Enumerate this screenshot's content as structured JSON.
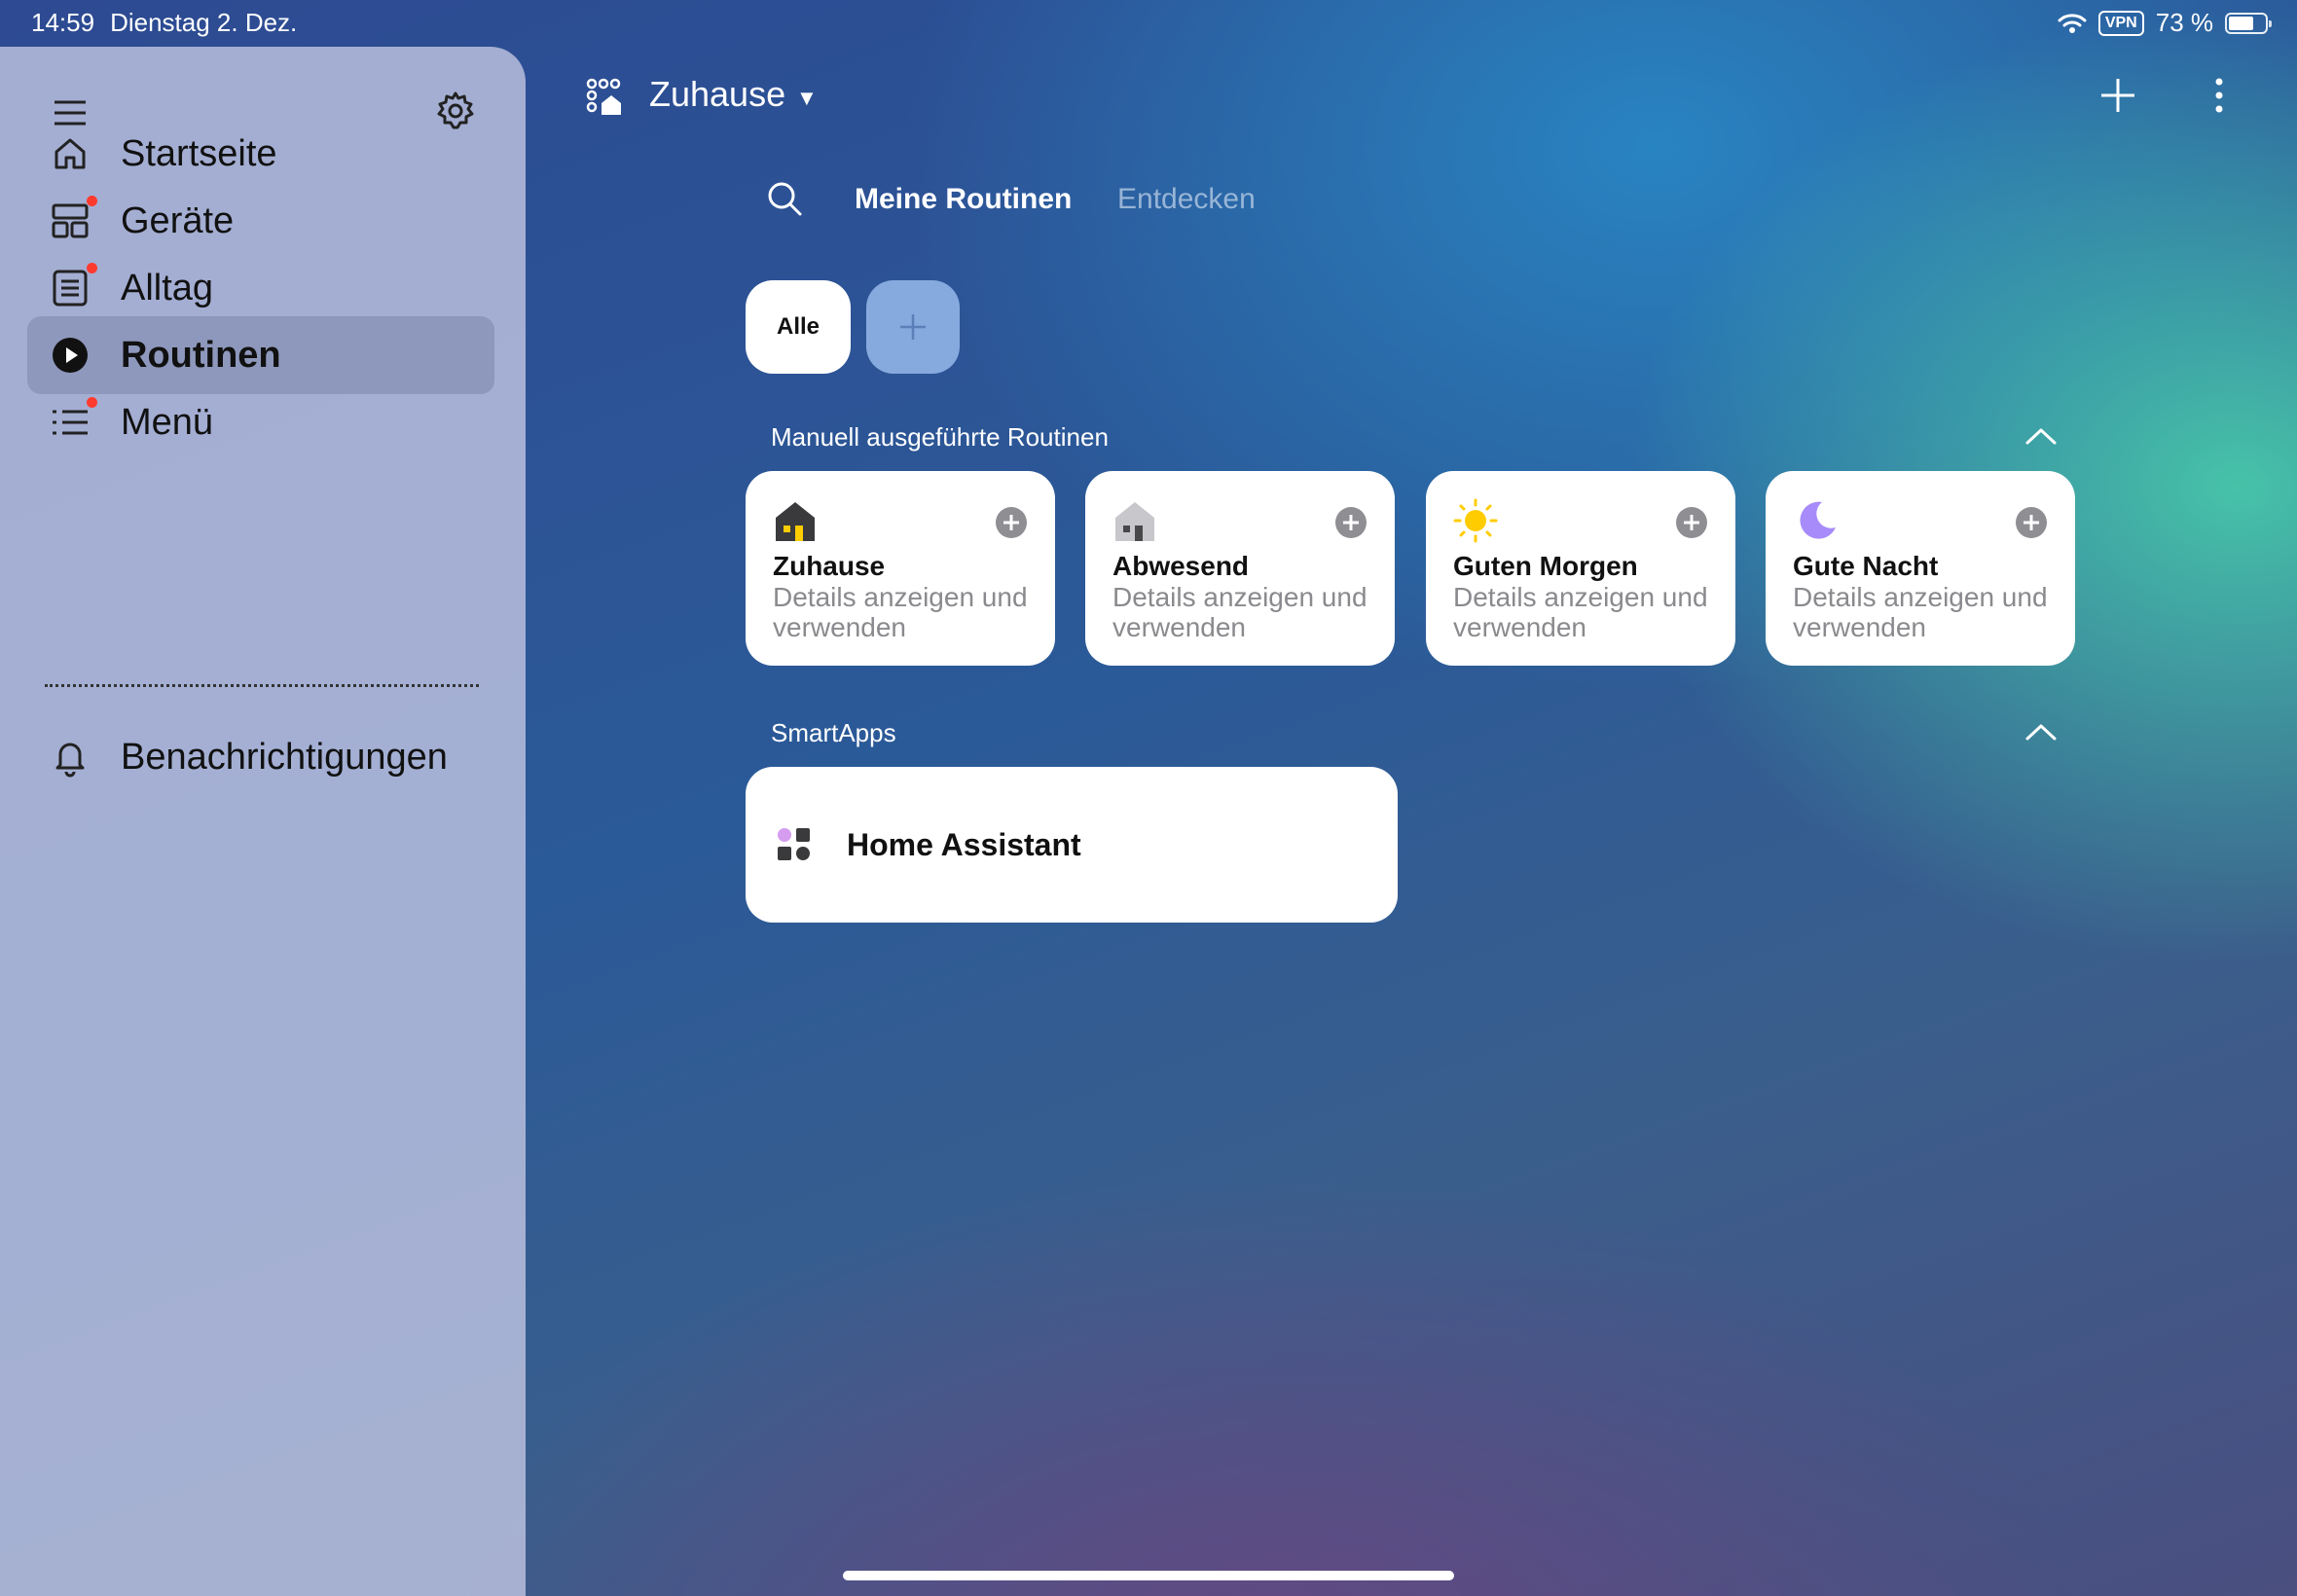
{
  "status_bar": {
    "time": "14:59",
    "date": "Dienstag 2. Dez.",
    "vpn": "VPN",
    "battery_text": "73 %",
    "battery_level": 0.73
  },
  "sidebar": {
    "items": [
      {
        "label": "Startseite",
        "icon": "house-icon",
        "badge": false,
        "active": false
      },
      {
        "label": "Geräte",
        "icon": "devices-icon",
        "badge": true,
        "active": false
      },
      {
        "label": "Alltag",
        "icon": "life-icon",
        "badge": true,
        "active": false
      },
      {
        "label": "Routinen",
        "icon": "play-icon",
        "badge": false,
        "active": true
      },
      {
        "label": "Menü",
        "icon": "list-icon",
        "badge": true,
        "active": false
      }
    ],
    "notifications_label": "Benachrichtigungen"
  },
  "header": {
    "home_title": "Zuhause"
  },
  "tabs": {
    "mine": "Meine Routinen",
    "discover": "Entdecken"
  },
  "filter": {
    "all": "Alle"
  },
  "sections": {
    "manual": {
      "title": "Manuell ausgeführte Routinen",
      "cards": [
        {
          "title": "Zuhause",
          "subtitle": "Details anzeigen und verwenden",
          "icon": "home-dark-icon"
        },
        {
          "title": "Abwesend",
          "subtitle": "Details anzeigen und verwenden",
          "icon": "home-away-icon"
        },
        {
          "title": "Guten Morgen",
          "subtitle": "Details anzeigen und verwenden",
          "icon": "sun-icon"
        },
        {
          "title": "Gute Nacht",
          "subtitle": "Details anzeigen und verwenden",
          "icon": "moon-icon"
        }
      ]
    },
    "smartapps": {
      "title": "SmartApps",
      "items": [
        {
          "label": "Home Assistant",
          "icon": "smartapp-icon"
        }
      ]
    }
  },
  "colors": {
    "accent_red": "#ff3b30",
    "sun": "#ffcc00",
    "moon": "#a78bfa",
    "chip_add": "#96b9eb"
  }
}
